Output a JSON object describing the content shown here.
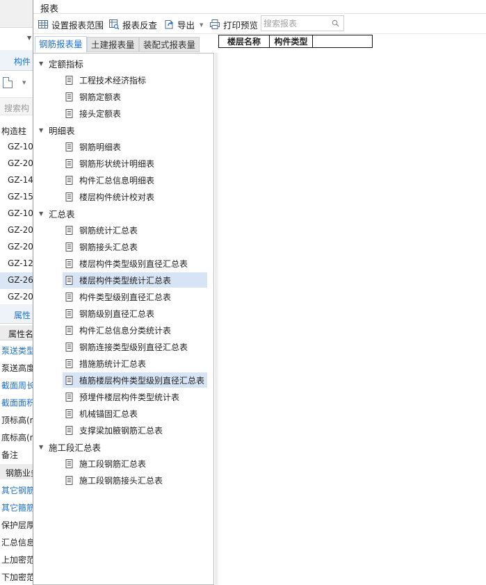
{
  "background_panel": {
    "tab_label": "构件",
    "search_placeholder": "搜索构",
    "component_type": "构造柱",
    "items": [
      "GZ-10",
      "GZ-20",
      "GZ-14",
      "GZ-15",
      "GZ-10",
      "GZ-20",
      "GZ-20",
      "GZ-12",
      "GZ-26",
      "GZ-20"
    ],
    "selected_index": 8,
    "properties_tab": "属性",
    "properties_header": "属性名",
    "properties": [
      {
        "label": "泵送类型",
        "link": true
      },
      {
        "label": "泵送高度",
        "link": false
      },
      {
        "label": "截面周长",
        "link": true
      },
      {
        "label": "截面面积",
        "link": true
      },
      {
        "label": "顶标高(m",
        "link": false
      },
      {
        "label": "底标高(m",
        "link": false
      },
      {
        "label": "备注",
        "link": false
      }
    ],
    "section_label": "钢筋业务",
    "properties2": [
      {
        "label": "其它钢筋",
        "link": true
      },
      {
        "label": "其它箍筋",
        "link": true
      },
      {
        "label": "保护层厚",
        "link": false
      },
      {
        "label": "汇总信息",
        "link": false
      },
      {
        "label": "上加密范",
        "link": false
      },
      {
        "label": "下加密范",
        "link": false
      }
    ]
  },
  "dialog": {
    "title": "报表",
    "toolbar": {
      "set_range": "设置报表范围",
      "reverse_check": "报表反查",
      "export": "导出",
      "print_preview": "打印预览",
      "search_placeholder": "搜索报表"
    },
    "tabs": [
      {
        "label": "钢筋报表量",
        "active": true
      },
      {
        "label": "土建报表量",
        "active": false
      },
      {
        "label": "装配式报表量",
        "active": false
      }
    ],
    "tree": [
      {
        "group": "定额指标",
        "items": [
          "工程技术经济指标",
          "钢筋定额表",
          "接头定额表"
        ]
      },
      {
        "group": "明细表",
        "items": [
          "钢筋明细表",
          "钢筋形状统计明细表",
          "构件汇总信息明细表",
          "楼层构件统计校对表"
        ]
      },
      {
        "group": "汇总表",
        "items": [
          "钢筋统计汇总表",
          "钢筋接头汇总表",
          "楼层构件类型级别直径汇总表",
          "楼层构件类型统计汇总表",
          "构件类型级别直径汇总表",
          "钢筋级别直径汇总表",
          "构件汇总信息分类统计表",
          "钢筋连接类型级别直径汇总表",
          "措施筋统计汇总表",
          "植筋楼层构件类型级别直径汇总表",
          "预埋件楼层构件类型统计表",
          "机械锚固汇总表",
          "支撑梁加腋钢筋汇总表"
        ]
      },
      {
        "group": "施工段汇总表",
        "items": [
          "施工段钢筋汇总表",
          "施工段钢筋接头汇总表"
        ]
      }
    ],
    "selected_items": [
      "楼层构件类型统计汇总表",
      "植筋楼层构件类型级别直径汇总表"
    ],
    "report_headers": [
      "楼层名称",
      "构件类型",
      ""
    ]
  }
}
